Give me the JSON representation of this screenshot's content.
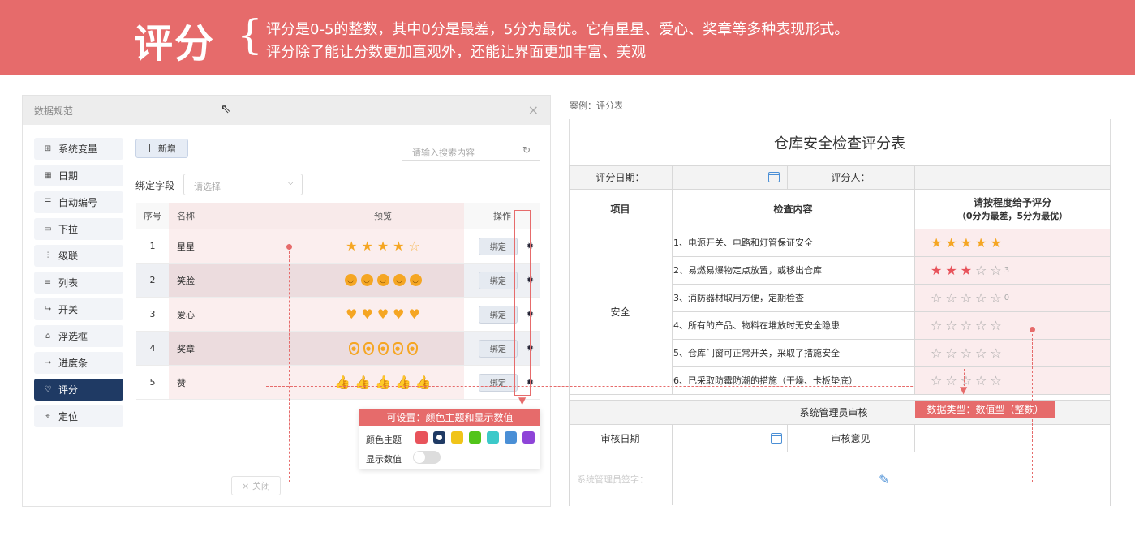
{
  "banner": {
    "title": "评分",
    "line1": "评分是0-5的整数，其中0分是最差，5分为最优。它有星星、爱心、奖章等多种表现形式。",
    "line2": "评分除了能让分数更加直观外，还能让界面更加丰富、美观"
  },
  "dialog": {
    "title": "数据规范",
    "close": "×",
    "sidebar": [
      {
        "label": "系统变量",
        "icon": "variable-icon"
      },
      {
        "label": "日期",
        "icon": "calendar-icon"
      },
      {
        "label": "自动编号",
        "icon": "list-number-icon"
      },
      {
        "label": "下拉",
        "icon": "dropdown-icon"
      },
      {
        "label": "级联",
        "icon": "cascade-icon"
      },
      {
        "label": "列表",
        "icon": "list-icon"
      },
      {
        "label": "开关",
        "icon": "switch-icon"
      },
      {
        "label": "浮选框",
        "icon": "float-box-icon"
      },
      {
        "label": "进度条",
        "icon": "progress-icon"
      },
      {
        "label": "评分",
        "icon": "heart-icon",
        "active": true
      },
      {
        "label": "定位",
        "icon": "location-icon"
      }
    ],
    "add_button": "新增",
    "search_placeholder": "请输入搜索内容",
    "bind_field_label": "绑定字段",
    "bind_field_placeholder": "请选择",
    "table": {
      "headers": [
        "序号",
        "名称",
        "预览",
        "操作"
      ],
      "rows": [
        {
          "index": "1",
          "name": "星星",
          "preview": "star",
          "action": "绑定"
        },
        {
          "index": "2",
          "name": "笑脸",
          "preview": "smile",
          "action": "绑定"
        },
        {
          "index": "3",
          "name": "爱心",
          "preview": "heart",
          "action": "绑定"
        },
        {
          "index": "4",
          "name": "奖章",
          "preview": "medal",
          "action": "绑定"
        },
        {
          "index": "5",
          "name": "赞",
          "preview": "thumb",
          "action": "绑定"
        }
      ]
    },
    "popup": {
      "header": "可设置：颜色主题和显示数值",
      "color_label": "颜色主题",
      "colors": [
        "#e8535b",
        "#1f3a64",
        "#f0c419",
        "#52c41a",
        "#3cc9c9",
        "#4a8fd6",
        "#8e44d8"
      ],
      "show_value_label": "显示数值",
      "show_value": false
    },
    "close_button": "× 关闭"
  },
  "case": {
    "label": "案例：评分表",
    "title": "仓库安全检查评分表",
    "date_label": "评分日期：",
    "rater_label": "评分人：",
    "col_item": "项目",
    "col_content": "检查内容",
    "col_score_line1": "请按程度给予评分",
    "col_score_line2": "（0分为最差，5分为最优）",
    "category": "安全",
    "items": [
      {
        "text": "1、电源开关、电路和灯管保证安全",
        "score": 5,
        "color": "orange",
        "show": ""
      },
      {
        "text": "2、易燃易爆物定点放置，或移出仓库",
        "score": 3,
        "color": "red",
        "show": "3"
      },
      {
        "text": "3、消防器材取用方便，定期检查",
        "score": 0,
        "color": "gray",
        "show": "0"
      },
      {
        "text": "4、所有的产品、物料在堆放时无安全隐患",
        "score": 0,
        "color": "gray",
        "show": ""
      },
      {
        "text": "5、仓库门窗可正常开关，采取了措施安全",
        "score": 0,
        "color": "gray",
        "show": ""
      },
      {
        "text": "6、已采取防霉防潮的措施（干燥、卡板垫底）",
        "score": 0,
        "color": "gray",
        "show": ""
      }
    ],
    "review_title": "系统管理员审核",
    "review_date_label": "审核日期",
    "review_opinion_label": "审核意见",
    "admin_sign_label": "系统管理员签字：",
    "data_type_tag": "数据类型：数值型（整数）"
  }
}
